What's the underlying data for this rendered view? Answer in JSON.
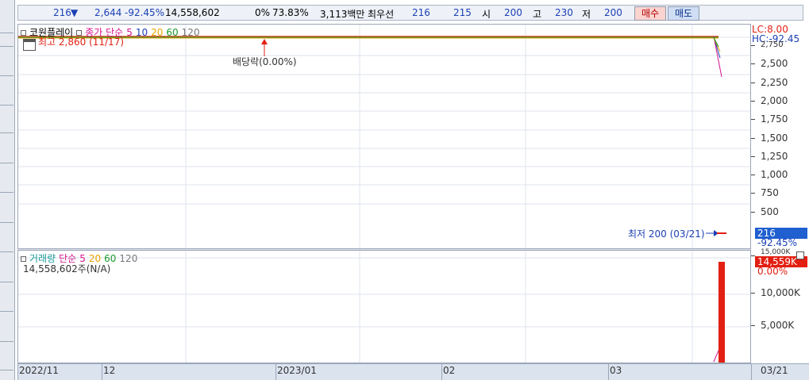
{
  "info_bar": {
    "price": "216",
    "change_arrow": "▼",
    "change": "2,644",
    "change_pct": "-92.45%",
    "volume": "14,558,602",
    "zero_pct": "0%",
    "ratio": "73.83%",
    "amount": "3,113백만",
    "best_label": "최우선",
    "best_ask": "216",
    "best_bid": "215",
    "open_label": "시",
    "open": "200",
    "high_label": "고",
    "high": "230",
    "low_label": "저",
    "low": "200",
    "buy_button": "매수",
    "sell_button": "매도"
  },
  "price_panel": {
    "legend": {
      "name": "코원플레이",
      "ma_label": "종가 단순",
      "periods": [
        "5",
        "10",
        "20",
        "60",
        "120"
      ],
      "period_colors": [
        "#d4148c",
        "#1b3fb5",
        "#e8a300",
        "#1a9a2e",
        "#777777"
      ]
    },
    "high_annotation": "최고 2,860 (11/17)",
    "dividend_annotation": "배당락(0.00%)",
    "low_annotation": "최저 200 (03/21)",
    "lc_label": "LC:8.00",
    "hc_label": "HC:-92.45",
    "current_badge": "216",
    "current_pct": "-92.45%",
    "y_labels": [
      "2,750",
      "2,500",
      "2,250",
      "2,000",
      "1,750",
      "1,500",
      "1,250",
      "1,000",
      "750",
      "500"
    ]
  },
  "volume_panel": {
    "legend": {
      "name": "거래량",
      "ma_label": "단순",
      "periods": [
        "5",
        "20",
        "60",
        "120"
      ],
      "period_colors": [
        "#d4148c",
        "#e8a300",
        "#1a9a2e",
        "#777777"
      ]
    },
    "value_text": "14,558,602주(N/A)",
    "current_badge": "14,559K",
    "pct_label": "0.00%",
    "y_labels": [
      "15,000K",
      "10,000K",
      "5,000K"
    ]
  },
  "x_axis": {
    "labels": [
      "2022/11",
      "12",
      "2023/01",
      "02",
      "03"
    ],
    "current_date": "03/21"
  },
  "colors": {
    "price_line": "#e23b1c",
    "volume_bar": "#e21f12",
    "badge_blue": "#1f5fd0",
    "badge_red": "#e21f12",
    "grid": "#dde3ec"
  }
}
